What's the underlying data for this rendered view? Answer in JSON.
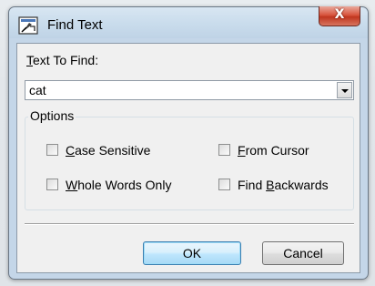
{
  "window": {
    "title": "Find Text",
    "close_glyph": "X"
  },
  "find": {
    "label_accel": "T",
    "label_rest": "ext To Find:",
    "value": "cat"
  },
  "options": {
    "group_label": "Options",
    "case_sensitive": {
      "accel": "C",
      "rest": "ase Sensitive",
      "checked": false
    },
    "whole_words": {
      "accel": "W",
      "rest": "hole Words Only",
      "checked": false
    },
    "from_cursor": {
      "accel": "F",
      "rest": "rom Cursor",
      "checked": false
    },
    "find_backwards": {
      "pre": "Find ",
      "accel": "B",
      "rest": "ackwards",
      "checked": false
    }
  },
  "buttons": {
    "ok": "OK",
    "cancel": "Cancel"
  }
}
